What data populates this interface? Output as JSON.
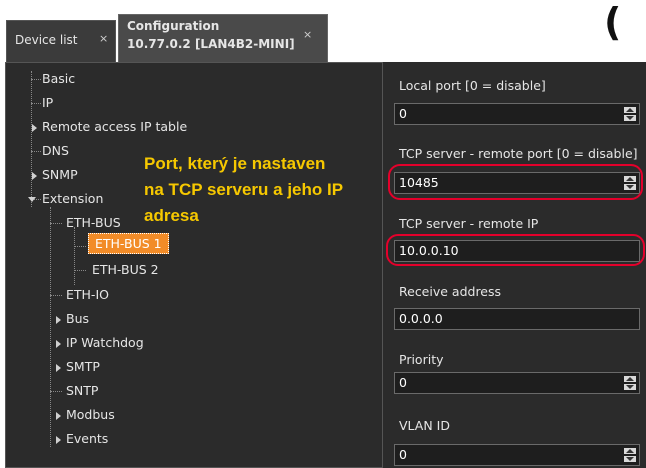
{
  "tabs": {
    "device_list": {
      "label": "Device list",
      "close": "×"
    },
    "configuration": {
      "line1": "Configuration",
      "line2": "10.77.0.2 [LAN4B2-MINI]",
      "close": "×"
    }
  },
  "corner_glyph": "(",
  "tree": {
    "basic": "Basic",
    "ip": "IP",
    "remote_access": "Remote access IP table",
    "dns": "DNS",
    "snmp": "SNMP",
    "extension": "Extension",
    "eth_bus": "ETH-BUS",
    "eth_bus_1": "ETH-BUS 1",
    "eth_bus_2": "ETH-BUS 2",
    "eth_io": "ETH-IO",
    "bus": "Bus",
    "ip_watchdog": "IP Watchdog",
    "smtp": "SMTP",
    "sntp": "SNTP",
    "modbus": "Modbus",
    "events": "Events"
  },
  "annotation": {
    "line1": "Port, který je nastaven",
    "line2": "na TCP serveru a jeho IP",
    "line3": "adresa"
  },
  "form": {
    "local_port": {
      "label": "Local port [0 = disable]",
      "value": "0"
    },
    "tcp_remote_port": {
      "label": "TCP server - remote port [0 = disable]",
      "value": "10485"
    },
    "tcp_remote_ip": {
      "label": "TCP server - remote IP",
      "value": "10.0.0.10"
    },
    "receive_address": {
      "label": "Receive address",
      "value": "0.0.0.0"
    },
    "priority": {
      "label": "Priority",
      "value": "0"
    },
    "vlan_id": {
      "label": "VLAN ID",
      "value": "0"
    }
  },
  "colors": {
    "panel_bg": "#2b2b2b",
    "selected_bg": "#f28c28",
    "annotation": "#f6c800",
    "highlight": "#e4002b"
  }
}
